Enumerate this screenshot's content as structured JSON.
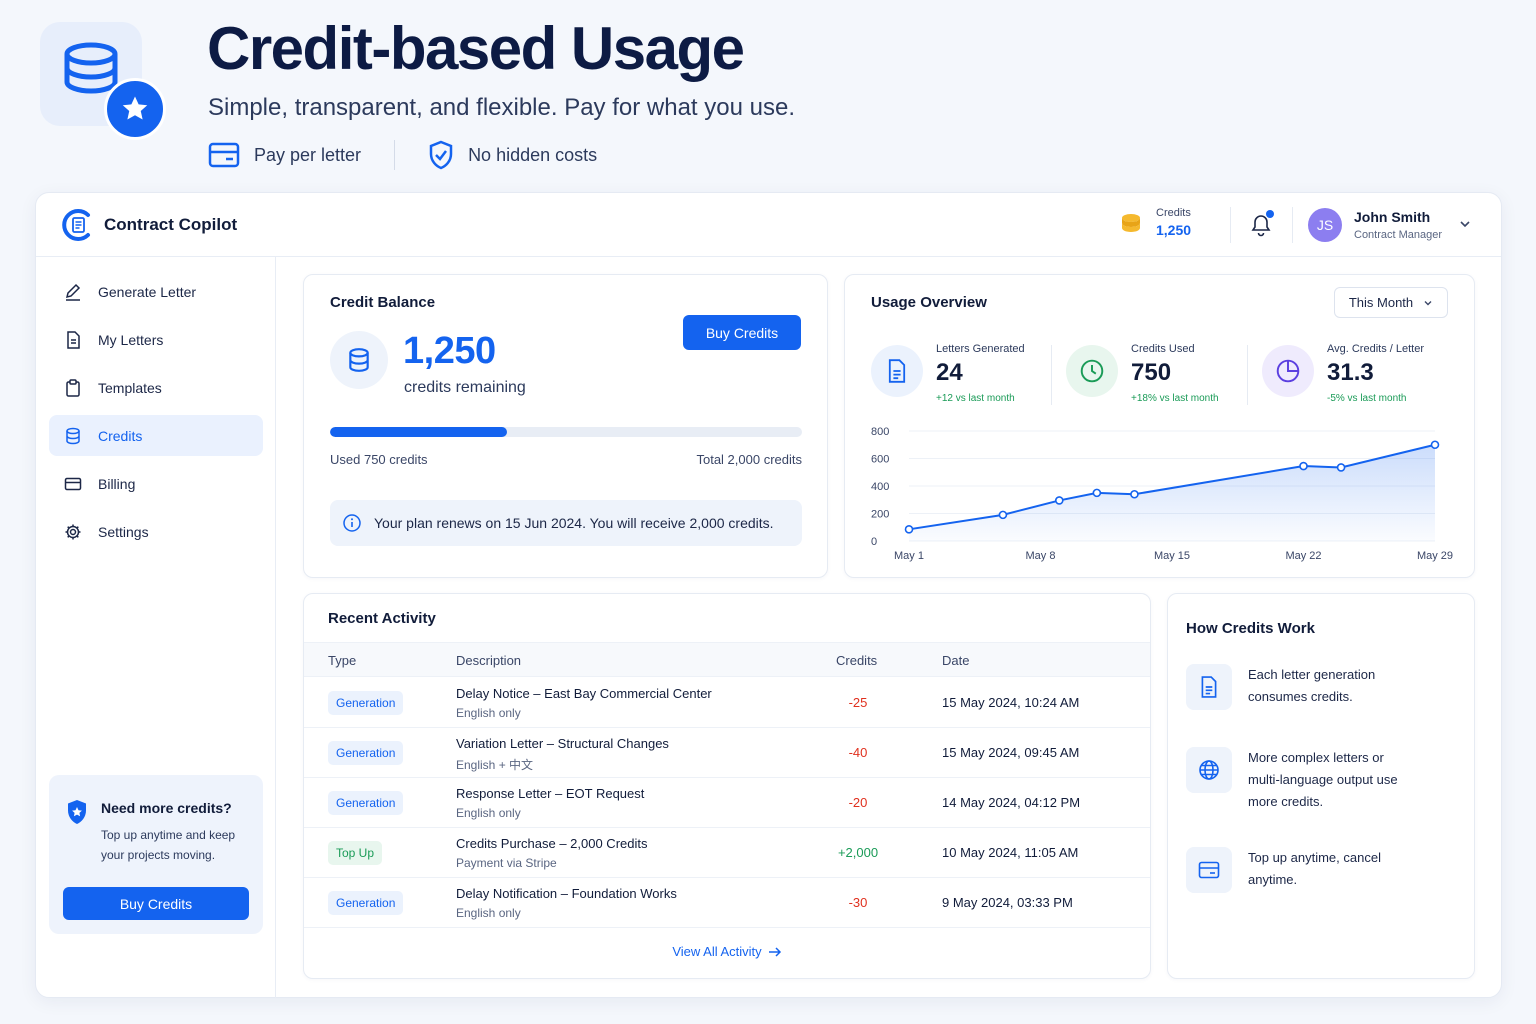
{
  "hero": {
    "title": "Credit-based Usage",
    "subtitle": "Simple, transparent, and flexible. Pay for what you use.",
    "features": [
      "Pay per letter",
      "No hidden costs"
    ]
  },
  "app": {
    "name": "Contract Copilot",
    "credits_label": "Credits",
    "credits_value": "1,250",
    "user": {
      "initials": "JS",
      "name": "John Smith",
      "role": "Contract Manager"
    }
  },
  "sidebar": {
    "items": [
      {
        "label": "Generate Letter",
        "icon": "pen-icon"
      },
      {
        "label": "My Letters",
        "icon": "document-icon"
      },
      {
        "label": "Templates",
        "icon": "clipboard-icon"
      },
      {
        "label": "Credits",
        "icon": "database-icon",
        "active": true
      },
      {
        "label": "Billing",
        "icon": "card-icon"
      },
      {
        "label": "Settings",
        "icon": "gear-icon"
      }
    ],
    "upsell": {
      "title": "Need more credits?",
      "text": "Top up anytime and keep your projects moving.",
      "button": "Buy Credits"
    }
  },
  "balance": {
    "title": "Credit Balance",
    "value": "1,250",
    "sub": "credits remaining",
    "button": "Buy Credits",
    "progress": 0.375,
    "used_label": "Used 750 credits",
    "total_label": "Total 2,000 credits",
    "renew_text": "Your plan renews on 15 Jun 2024. You will receive 2,000 credits."
  },
  "usage": {
    "title": "Usage Overview",
    "period": "This Month",
    "kpis": [
      {
        "label": "Letters Generated",
        "value": "24",
        "delta": "+12 vs last month",
        "color": "#1463ef"
      },
      {
        "label": "Credits Used",
        "value": "750",
        "delta": "+18% vs last month",
        "color": "#1a9b57"
      },
      {
        "label": "Avg. Credits / Letter",
        "value": "31.3",
        "delta": "-5% vs last month",
        "color": "#5b3fe0"
      }
    ]
  },
  "chart_data": {
    "type": "area",
    "title": "",
    "xlabel": "",
    "ylabel": "",
    "ylim": [
      0,
      800
    ],
    "yticks": [
      "0",
      "200",
      "400",
      "600",
      "800"
    ],
    "xticks": [
      "May 1",
      "May 8",
      "May 15",
      "May 22",
      "May 29"
    ],
    "x": [
      "May 1",
      "May 6",
      "May 9",
      "May 11",
      "May 13",
      "May 22",
      "May 24",
      "May 29"
    ],
    "series": [
      {
        "values": [
          85,
          190,
          295,
          350,
          340,
          545,
          535,
          700
        ]
      }
    ],
    "color": "#1463ef",
    "grid": true
  },
  "activity": {
    "title": "Recent Activity",
    "columns": [
      "Type",
      "Description",
      "Credits",
      "Date"
    ],
    "rows": [
      {
        "type": "Generation",
        "kind": "gen",
        "desc": "Delay Notice – East Bay Commercial Center",
        "sub": "English only",
        "credits": "-25",
        "date": "15 May 2024, 10:24 AM"
      },
      {
        "type": "Generation",
        "kind": "gen",
        "desc": "Variation Letter – Structural Changes",
        "sub": "English + 中文",
        "credits": "-40",
        "date": "15 May 2024, 09:45 AM"
      },
      {
        "type": "Generation",
        "kind": "gen",
        "desc": "Response Letter – EOT Request",
        "sub": "English only",
        "credits": "-20",
        "date": "14 May 2024, 04:12 PM"
      },
      {
        "type": "Top Up",
        "kind": "top",
        "desc": "Credits Purchase – 2,000 Credits",
        "sub": "Payment via Stripe",
        "credits": "+2,000",
        "date": "10 May 2024, 11:05 AM"
      },
      {
        "type": "Generation",
        "kind": "gen",
        "desc": "Delay Notification – Foundation Works",
        "sub": "English only",
        "credits": "-30",
        "date": "9 May 2024, 03:33 PM"
      }
    ],
    "view_all": "View All Activity"
  },
  "how": {
    "title": "How Credits Work",
    "items": [
      {
        "icon": "document-icon",
        "text": "Each letter generation consumes credits."
      },
      {
        "icon": "globe-icon",
        "text": "More complex letters or multi-language output use more credits."
      },
      {
        "icon": "card-icon",
        "text": "Top up anytime, cancel anytime."
      }
    ]
  }
}
